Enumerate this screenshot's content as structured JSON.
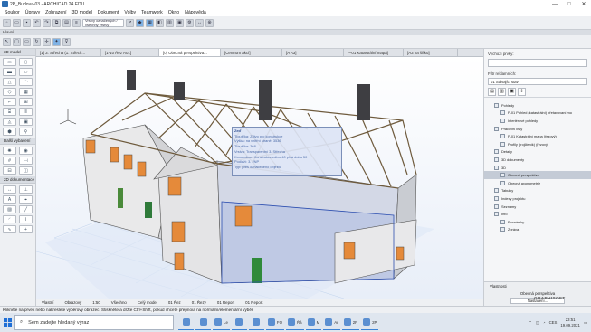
{
  "window": {
    "title": "2P_Budova-03 - ARCHICAD 24 EDU",
    "controls": [
      "—",
      "□",
      "✕"
    ]
  },
  "menu": [
    "Soubor",
    "Úpravy",
    "Zobrazení",
    "3D model",
    "Dokument",
    "Volby",
    "Teamwork",
    "Okno",
    "Nápověda"
  ],
  "toolbar": {
    "combo_label": "Vrstvy označených / všechny vrstvy"
  },
  "infobox": {
    "label": "Hlavní:"
  },
  "toolbox": {
    "sections": [
      {
        "label": "3D model"
      },
      {
        "label": "Další vybavení"
      },
      {
        "label": "2D dokumentace"
      }
    ]
  },
  "tabs": [
    "[1] 3. Střecha (1. Střech...",
    "[1-10 Řez A01]",
    "[0] Obecná perspektiva...",
    "[Centrum akcí]",
    "[A A3]",
    "P-01 Katastrální mapa]",
    "[A3 na šířku]"
  ],
  "active_tab_index": 2,
  "tooltip": {
    "title": "Zeď",
    "lines": [
      "Tloušťka: Zdivo pro konstrukce",
      "Výška: na vnitřní straně: 3536",
      "Tloušťka: 368",
      "Vrstva: Transparentní 3. Střecha",
      "Konstrukce: Konstrukce zdivo 40 plná doba 50",
      "Podlaží: 3. 2NP",
      "Typ: přes označeného objektu"
    ]
  },
  "bottombar": {
    "items": [
      "Vlastní",
      "Obrazový",
      "1:50",
      "Všechno",
      "Celý model",
      "01 Řez",
      "01 Řezy",
      "01 Report",
      "01 Report"
    ]
  },
  "navigator": {
    "label_top": "Výchozí prvky:",
    "label_filter": "Filtr reklamních:",
    "filter_value": "01 Stávající stav",
    "tree": [
      {
        "label": "Pohledy",
        "indent": 1,
        "selected": false
      },
      {
        "label": "P-01 Pohled (katastrální) přetavovaní mo",
        "indent": 2,
        "selected": false
      },
      {
        "label": "Interiérové pohledy",
        "indent": 2,
        "selected": false
      },
      {
        "label": "Pracovní listy",
        "indent": 1,
        "selected": false
      },
      {
        "label": "P-01 Katastrální mapa (řezový)",
        "indent": 2,
        "selected": false
      },
      {
        "label": "Profily (trojčleník) (řezový)",
        "indent": 2,
        "selected": false
      },
      {
        "label": "Detaily",
        "indent": 1,
        "selected": false
      },
      {
        "label": "3D dokumenty",
        "indent": 1,
        "selected": false
      },
      {
        "label": "3D",
        "indent": 1,
        "selected": false
      },
      {
        "label": "Obecná perspektiva",
        "indent": 2,
        "selected": true
      },
      {
        "label": "Obecná axonometrie",
        "indent": 2,
        "selected": false
      },
      {
        "label": "Tabulky",
        "indent": 1,
        "selected": false
      },
      {
        "label": "Indexy projektu",
        "indent": 1,
        "selected": false
      },
      {
        "label": "Seznamy",
        "indent": 1,
        "selected": false
      },
      {
        "label": "Info",
        "indent": 1,
        "selected": false
      },
      {
        "label": "Poznámky",
        "indent": 2,
        "selected": false
      },
      {
        "label": "Zpráva",
        "indent": 2,
        "selected": false
      }
    ],
    "props_label": "Vlastnosti",
    "props_value": "Obecná perspektiva",
    "props_button": "Nastavení..."
  },
  "statusbar": "Klikněte na prvek nebo nakreslete výběrový obrazec. Stiskněte a držte Ctrl+Shift, pokud chcete přepnout na normální/elementární výběr.",
  "taskbar": {
    "search_placeholder": "Sem zadejte hledaný výraz",
    "apps": [
      {
        "label": "",
        "icon": "task-view-icon"
      },
      {
        "label": "",
        "icon": "edge-icon"
      },
      {
        "label": "Le",
        "icon": "explorer-icon"
      },
      {
        "label": "",
        "icon": "store-icon"
      },
      {
        "label": "",
        "icon": "mail-icon"
      },
      {
        "label": "FO",
        "icon": "folder-icon"
      },
      {
        "label": "Řá",
        "icon": "archicad-icon"
      },
      {
        "label": "M",
        "icon": "app-icon"
      },
      {
        "label": "Ar",
        "icon": "archicad-icon"
      },
      {
        "label": "2P",
        "icon": "archicad-icon"
      },
      {
        "label": "2P",
        "icon": "archicad-icon"
      }
    ],
    "lang": "CES",
    "time": "23:51",
    "date": "19.09.2021"
  },
  "graphisoft_logo": "GRAPHISOFT"
}
